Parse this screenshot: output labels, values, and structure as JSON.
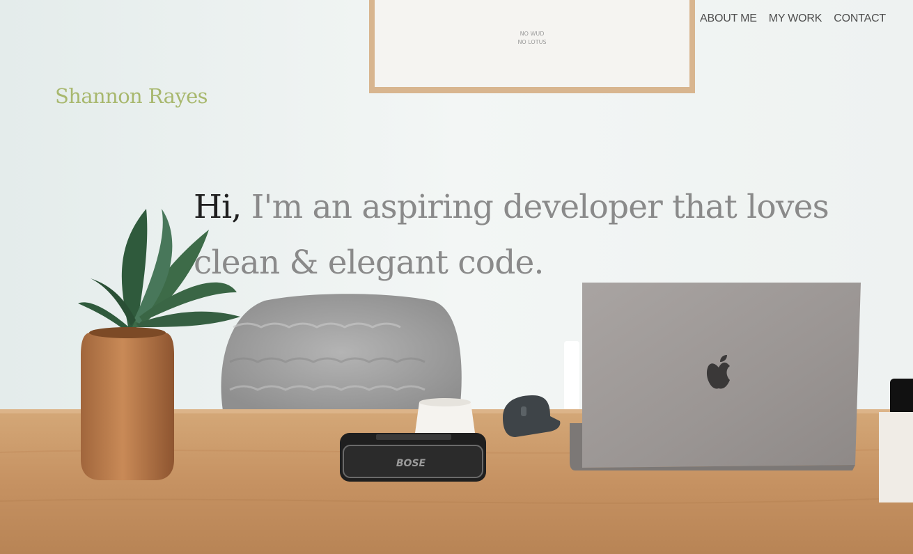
{
  "nav": {
    "about": "About me",
    "work": "My work",
    "contact": "Contact"
  },
  "brand": "Shannon Rayes",
  "hero": {
    "greeting": "Hi,",
    "text": " I'm an aspiring developer that loves clean & elegant code."
  },
  "background": {
    "poster_text_line1": "NO WUD",
    "poster_text_line2": "NO LOTUS",
    "speaker_brand": "BOSE"
  },
  "colors": {
    "brand": "#a8b86e",
    "nav_text": "#4f4f4f",
    "hero_greeting": "#1f1f1f",
    "hero_text": "#8a8a8a"
  }
}
